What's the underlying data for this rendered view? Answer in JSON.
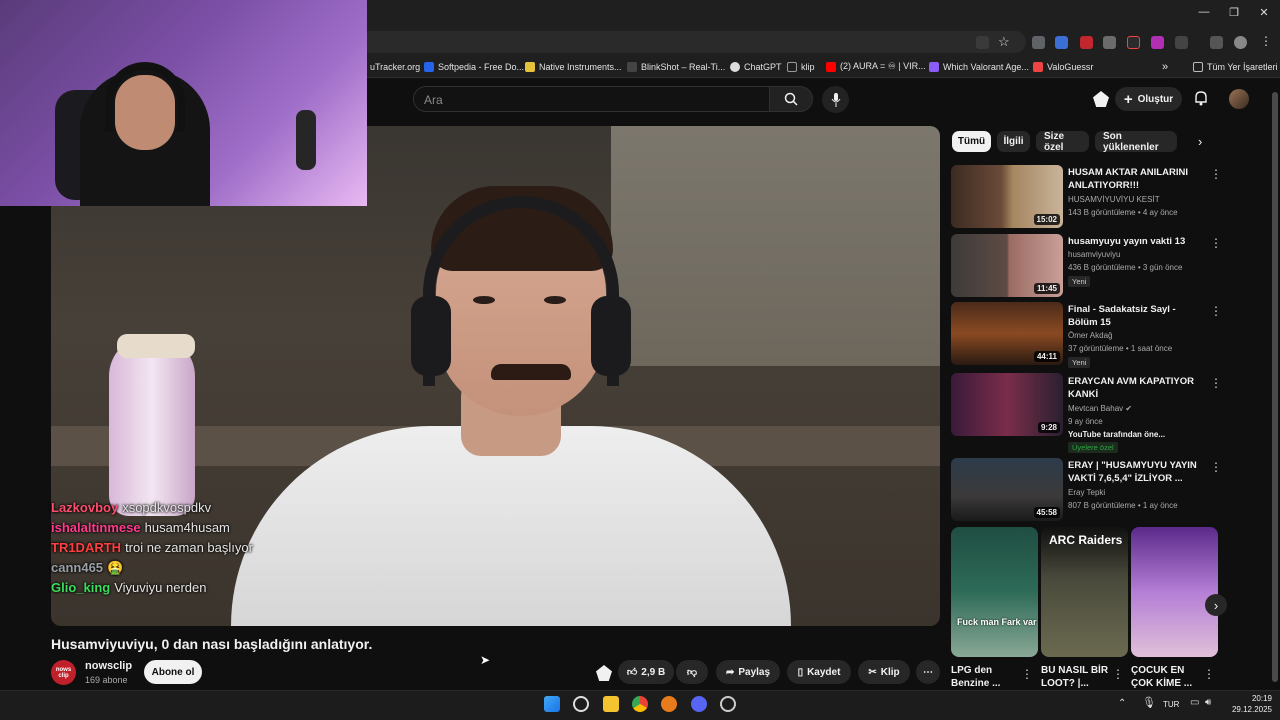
{
  "browser": {
    "bookmarks": [
      {
        "label": "uTracker.org",
        "color": "#3b82f6"
      },
      {
        "label": "Softpedia - Free Do...",
        "color": "#2563eb"
      },
      {
        "label": "Native Instruments...",
        "color": "#e5c23b"
      },
      {
        "label": "BlinkShot – Real-Ti...",
        "color": "#444444"
      },
      {
        "label": "ChatGPT",
        "color": "#dddddd"
      },
      {
        "label": "klip",
        "color": "#999999"
      },
      {
        "label": "(2) AURA = ♾ | VIR...",
        "color": "#ff0000"
      },
      {
        "label": "Which Valorant Age...",
        "color": "#8b5cf6"
      },
      {
        "label": "ValoGuessr",
        "color": "#ef4444"
      }
    ],
    "more_bookmarks": "»",
    "all_bookmarks": "Tüm Yer İşaretleri"
  },
  "masthead": {
    "search_placeholder": "Ara",
    "create_label": "Oluştur"
  },
  "chat": [
    {
      "user": "Lazkovboy",
      "msg": "xsopdkvospdkv",
      "color": "#ff4d6d"
    },
    {
      "user": "ishalaltinmese",
      "msg": "husam4husam",
      "color": "#ff3b8d"
    },
    {
      "user": "TR1DARTH",
      "msg": "troi ne zaman başlıyor",
      "color": "#ff4040"
    },
    {
      "user": "cann465",
      "msg": "🤮",
      "color": "#9aa0a6"
    },
    {
      "user": "Glio_king",
      "msg": "Viyuviyu nerden",
      "color": "#3ddc5c"
    }
  ],
  "video": {
    "title": "Husamviyuviyu, 0 dan nası başladığını anlatıyor.",
    "channel": "nowsclip",
    "channel_avatar_text": "nows clip",
    "subscribers": "169 abone",
    "subscribe_label": "Abone ol",
    "likes": "2,9 B",
    "share_label": "Paylaş",
    "save_label": "Kaydet",
    "clip_label": "Klip"
  },
  "chips": [
    "Tümü",
    "İlgili",
    "Size özel",
    "Son yüklenenler"
  ],
  "related": [
    {
      "title": "HUSAM AKTAR ANILARINI ANLATIYORR!!!",
      "channel": "HUSAMVİYUVİYU KESİT",
      "meta": "143 B görüntüleme • 4 ay önce",
      "duration": "15:02",
      "badge": "",
      "extra": ""
    },
    {
      "title": "husamyuyu yayın vakti 13",
      "channel": "husamviyuviyu",
      "meta": "436 B görüntüleme • 3 gün önce",
      "duration": "11:45",
      "badge": "Yeni",
      "extra": ""
    },
    {
      "title": "Final - Sadakatsiz Sayl - Bölüm 15",
      "channel": "Ömer Akdağ",
      "meta": "37 görüntüleme • 1 saat önce",
      "duration": "44:11",
      "badge": "Yeni",
      "extra": ""
    },
    {
      "title": "ERAYCAN AVM KAPATIYOR KANKİ",
      "channel": "Mevtcan Bahav",
      "meta": "9 ay önce",
      "duration": "9:28",
      "badge": "",
      "extra": "YouTube tarafından öne...",
      "members": "Üyelere özel"
    },
    {
      "title": "ERAY | \"HUSAMYUYU YAYIN VAKTİ 7,6,5,4\" İZLİYOR ...",
      "channel": "Eray Tepki",
      "meta": "807 B görüntüleme • 1 ay önce",
      "duration": "45:58",
      "badge": "",
      "extra": ""
    }
  ],
  "shorts": [
    {
      "title": "LPG den Benzine ...",
      "overlay": "Fuck man Fark var"
    },
    {
      "title": "BU NASIL BİR LOOT? |...",
      "overlay": "ARC Raiders"
    },
    {
      "title": "ÇOCUK EN ÇOK KİME ...",
      "overlay": ""
    }
  ],
  "taskbar": {
    "language": "TUR",
    "time": "20:19",
    "date": "29.12.2025"
  }
}
